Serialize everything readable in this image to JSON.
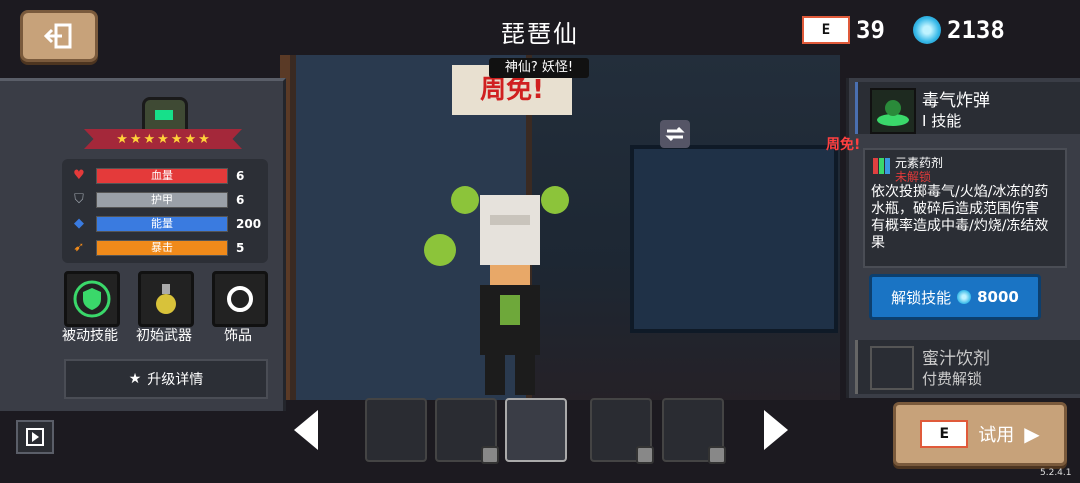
{
  "header": {
    "title": "琵琶仙",
    "back_icon": "exit-door-icon",
    "gift_card_count": "39",
    "gem_count": "2138"
  },
  "speech_bubble": "神仙? 妖怪!",
  "hero_panel": {
    "star_count": 7,
    "stats": [
      {
        "label": "血量",
        "value": "6",
        "color": "#e43a3a",
        "icon": "heart-icon",
        "fill": 1.0
      },
      {
        "label": "护甲",
        "value": "6",
        "color": "#9aa0a8",
        "icon": "shield-icon",
        "fill": 1.0
      },
      {
        "label": "能量",
        "value": "200",
        "color": "#3a7be0",
        "icon": "diamond-icon",
        "fill": 1.0
      },
      {
        "label": "暴击",
        "value": "5",
        "color": "#f08a1a",
        "icon": "crit-icon",
        "fill": 1.0
      }
    ],
    "slots": [
      {
        "label": "被动技能",
        "icon": "passive-shield-icon"
      },
      {
        "label": "初始武器",
        "icon": "potion-flask-icon"
      },
      {
        "label": "饰品",
        "icon": "ring-icon"
      }
    ],
    "upgrade_label": "升级详情"
  },
  "skill_panel": {
    "skill_name": "毒气炸弹",
    "skill_type": "技能",
    "skill_type_marker": "I",
    "zhoumian_tag": "周免!",
    "desc_title": "元素药剂",
    "desc_status": "未解锁",
    "desc_text": "依次投掷毒气/火焰/冰冻的药水瓶，破碎后造成范围伤害 有概率造成中毒/灼烧/冻结效果",
    "unlock_label": "解锁技能",
    "unlock_cost": "8000",
    "skill2_name": "蜜汁饮剂",
    "skill2_type": "付费解锁"
  },
  "character_bar": {
    "thumbs": [
      {
        "name": "engineer-thumb",
        "locked": false
      },
      {
        "name": "robot-thumb",
        "locked": true
      },
      {
        "name": "pipa-immortal-thumb",
        "locked": false,
        "selected": true
      },
      {
        "name": "elephant-thumb",
        "locked": true
      },
      {
        "name": "beast-thumb",
        "locked": true
      }
    ]
  },
  "try_button": {
    "label": "试用"
  },
  "version": "5.2.4.1"
}
